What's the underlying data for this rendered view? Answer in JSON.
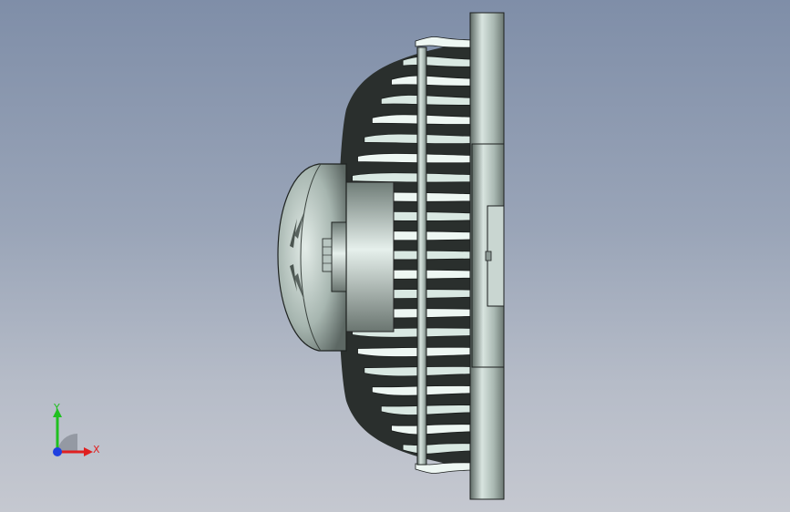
{
  "viewport": {
    "background_top": "#7f8ea8",
    "background_bottom": "#c5c8d0"
  },
  "model": {
    "part_color": "#b7c7c0",
    "edge_color": "#000000"
  },
  "triad": {
    "x_label": "X",
    "y_label": "Y",
    "x_color": "#e02020",
    "y_color": "#20c020",
    "z_color": "#2040e0"
  }
}
